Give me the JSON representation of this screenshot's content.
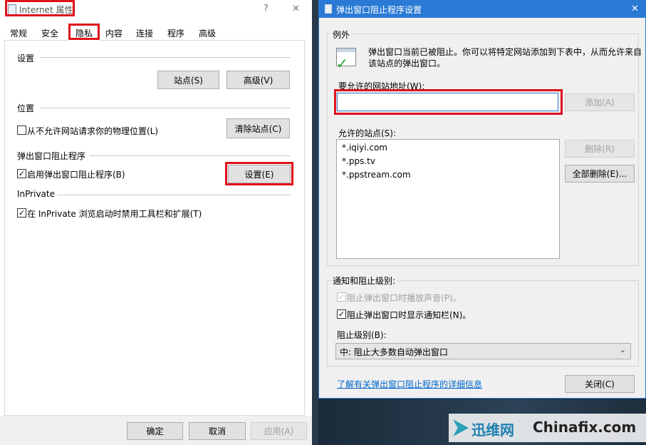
{
  "left_dialog": {
    "title": "Internet 属性",
    "help_symbol": "?",
    "close_symbol": "✕",
    "tabs": [
      "常规",
      "安全",
      "隐私",
      "内容",
      "连接",
      "程序",
      "高级"
    ],
    "settings_label": "设置",
    "sites_button": "站点(S)",
    "advanced_button": "高级(V)",
    "location_label": "位置",
    "location_checkbox": "从不允许网站请求你的物理位置(L)",
    "clear_sites_button": "清除站点(C)",
    "popup_label": "弹出窗口阻止程序",
    "popup_checkbox": "启用弹出窗口阻止程序(B)",
    "popup_settings_button": "设置(E)",
    "inprivate_label": "InPrivate",
    "inprivate_checkbox": "在 InPrivate 浏览启动时禁用工具栏和扩展(T)",
    "ok_button": "确定",
    "cancel_button": "取消",
    "apply_button": "应用(A)"
  },
  "right_dialog": {
    "title": "弹出窗口阻止程序设置",
    "close_symbol": "✕",
    "exceptions_label": "例外",
    "description": [
      "弹出窗口当前已被阻止。你可以将特定网站添加到下表中，从而允许来自",
      "该站点的弹出窗口。"
    ],
    "address_label": "要允许的网站地址(W):",
    "address_value": "",
    "add_button": "添加(A)",
    "allowed_label": "允许的站点(S):",
    "allowed_sites": [
      "*.iqiyi.com",
      "*.pps.tv",
      "*.ppstream.com"
    ],
    "remove_button": "删除(R)",
    "remove_all_button": "全部删除(E)...",
    "notify_label": "通知和阻止级别:",
    "sound_checkbox": "阻止弹出窗口时播放声音(P)。",
    "notify_checkbox": "阻止弹出窗口时显示通知栏(N)。",
    "level_label": "阻止级别(B):",
    "level_value": "中: 阻止大多数自动弹出窗口",
    "learn_more_link": "了解有关弹出窗口阻止程序的详细信息",
    "close_button": "关闭(C)"
  },
  "watermark": {
    "brand_cn": "迅维网",
    "brand_en": "Chinafix.com"
  },
  "colors": {
    "highlight_red": "#e0101d",
    "link_blue": "#0066cc",
    "title_accent": "#2a7ad5"
  }
}
